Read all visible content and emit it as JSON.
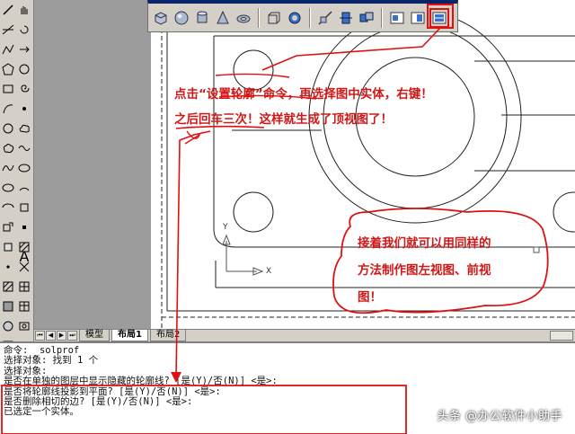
{
  "draw_toolbar": {
    "col_a": [
      "line-icon",
      "construction-line-icon",
      "polyline-icon",
      "polygon-icon",
      "rectangle-icon",
      "arc-icon",
      "circle-icon",
      "revcloud-icon",
      "spline-icon",
      "ellipse-icon",
      "ellipse-arc-icon",
      "insert-block-icon",
      "make-block-icon",
      "point-icon",
      "hatch-icon",
      "gradient-icon",
      "region-icon",
      "table-icon"
    ],
    "col_b": [
      "pan-hand-icon",
      "rotate-icon",
      "arrow-icon",
      "circle-icon",
      "spiral-icon",
      "dot-icon",
      "cloud-icon",
      "wave-icon",
      "ellipse-icon",
      "rotate-arc-icon",
      "block-icon",
      "grip-icon",
      "hatch-icon",
      "cross-icon",
      "grid-icon",
      "table-icon",
      "image-icon"
    ],
    "text_tool_label": "A"
  },
  "solids_toolbar": {
    "buttons": [
      "box-icon",
      "sphere-icon",
      "cylinder-icon",
      "cone-icon",
      "torus-icon",
      "extrude-icon",
      "revolve-icon",
      "slice-icon",
      "section-icon",
      "interfere-icon",
      "setup-drawing-icon",
      "setup-view-icon",
      "setup-profile-icon"
    ]
  },
  "annotations": {
    "line1": "点击“设置轮廓”命令，再选择图中实体，右键！",
    "line2": "之后回车三次！这样就生成了顶视图了！",
    "bubble_line1": "接着我们就可以用同样的",
    "bubble_line2": "方法制作图左视图、前视",
    "bubble_line3": "图！"
  },
  "ucs": {
    "y_label": "Y",
    "x_label": "X"
  },
  "tabs": {
    "nav": [
      "⏮",
      "◀",
      "▶",
      "⏭"
    ],
    "items": [
      "模型",
      "布局1",
      "布局2"
    ],
    "active": "布局1"
  },
  "command_window": {
    "lines": [
      "命令: _solprof",
      "选择对象: 找到 1 个",
      "选择对象:",
      "是否在单独的图层中显示隐藏的轮廓线? [是(Y)/否(N)] <是>:",
      "是否将轮廓线投影到平面? [是(Y)/否(N)] <是>:",
      "是否删除相切的边? [是(Y)/否(N)] <是>:",
      "已选定一个实体。"
    ]
  },
  "watermark": "头条 @办公软件小助手",
  "colors": {
    "annotation": "#d01818",
    "toolbar": "#d4d0c8",
    "titlebar": "#0a246a"
  }
}
